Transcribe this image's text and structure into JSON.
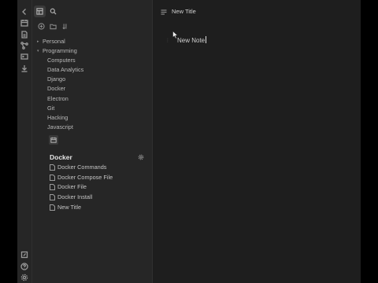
{
  "ribbon": {
    "icons": [
      "chevron-left-icon",
      "calendar-icon",
      "document-icon",
      "graph-icon",
      "terminal-icon",
      "download-icon"
    ],
    "bottom_icons": [
      "vault-icon",
      "help-icon",
      "settings-icon"
    ]
  },
  "sidebar": {
    "tabs": [
      "files-icon",
      "search-icon"
    ],
    "actions": [
      "new-note-icon",
      "new-folder-icon",
      "sort-icon"
    ],
    "tree": [
      {
        "label": "Personal",
        "collapsed": true,
        "depth": 0
      },
      {
        "label": "Programming",
        "collapsed": false,
        "depth": 0
      },
      {
        "label": "Computers",
        "depth": 1
      },
      {
        "label": "Data Analytics",
        "depth": 1
      },
      {
        "label": "Django",
        "depth": 1
      },
      {
        "label": "Docker",
        "depth": 1
      },
      {
        "label": "Electron",
        "depth": 1
      },
      {
        "label": "Git",
        "depth": 1
      },
      {
        "label": "Hacking",
        "depth": 1
      },
      {
        "label": "Javascript",
        "depth": 1
      }
    ],
    "panel": {
      "title": "Docker",
      "notes": [
        "Docker Commands",
        "Docker Compose File",
        "Docker File",
        "Docker Install",
        "New Title"
      ]
    }
  },
  "editor": {
    "title": "New Title",
    "body_text": "New Note"
  },
  "colors": {
    "background": "#1e1e1e",
    "sidebar": "#262626",
    "text": "#c8c8c8"
  }
}
